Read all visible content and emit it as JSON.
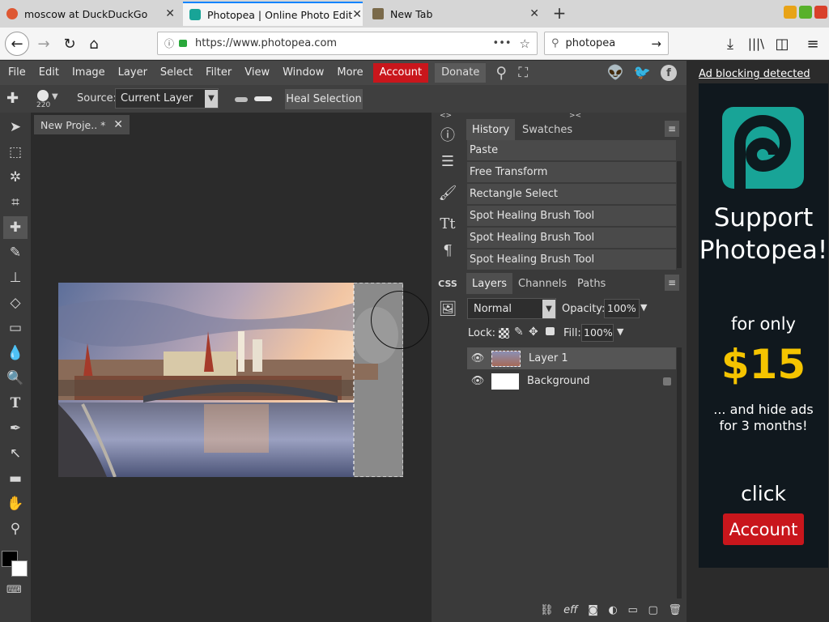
{
  "browser": {
    "tabs": [
      {
        "label": "moscow at DuckDuckGo",
        "close": "✕"
      },
      {
        "label": "Photopea | Online Photo Edit",
        "close": "✕"
      },
      {
        "label": "New Tab",
        "close": "✕"
      }
    ],
    "new_tab": "+",
    "url": "https://www.photopea.com",
    "url_more": "•••",
    "search_value": "photopea",
    "colors": {
      "active_tab_accent": "#0a84ff",
      "min": "#e8a317",
      "max": "#58b12b",
      "close": "#d9412b"
    }
  },
  "menu": {
    "items": [
      "File",
      "Edit",
      "Image",
      "Layer",
      "Select",
      "Filter",
      "View",
      "Window",
      "More"
    ],
    "account": "Account",
    "donate": "Donate",
    "account_color": "#c9161c"
  },
  "options": {
    "brush_size": "220",
    "source_label": "Source:",
    "source_value": "Current Layer",
    "heal_selection": "Heal Selection"
  },
  "document": {
    "tab_title": "New Proje.. *",
    "tab_close": "✕"
  },
  "side": {
    "collapse_left": "<>",
    "collapse_right": "><",
    "css_label": "CSS"
  },
  "history": {
    "tabs": [
      "History",
      "Swatches"
    ],
    "items": [
      "Paste",
      "Free Transform",
      "Rectangle Select",
      "Spot Healing Brush Tool",
      "Spot Healing Brush Tool",
      "Spot Healing Brush Tool"
    ]
  },
  "layers": {
    "tabs": [
      "Layers",
      "Channels",
      "Paths"
    ],
    "blend_mode": "Normal",
    "opacity_label": "Opacity:",
    "opacity_value": "100%",
    "lock_label": "Lock:",
    "fill_label": "Fill:",
    "fill_value": "100%",
    "items": [
      {
        "name": "Layer 1"
      },
      {
        "name": "Background"
      }
    ],
    "footer_eff": "eff"
  },
  "ad": {
    "blocked_link": "Ad blocking detected",
    "headline_1": "Support",
    "headline_2": "Photopea!",
    "for_only": "for only",
    "price": "$15",
    "hide_1": "... and hide ads",
    "hide_2": "for 3 months!",
    "click": "click",
    "account_button": "Account",
    "price_color": "#f5c400",
    "logo_color": "#18a497"
  }
}
